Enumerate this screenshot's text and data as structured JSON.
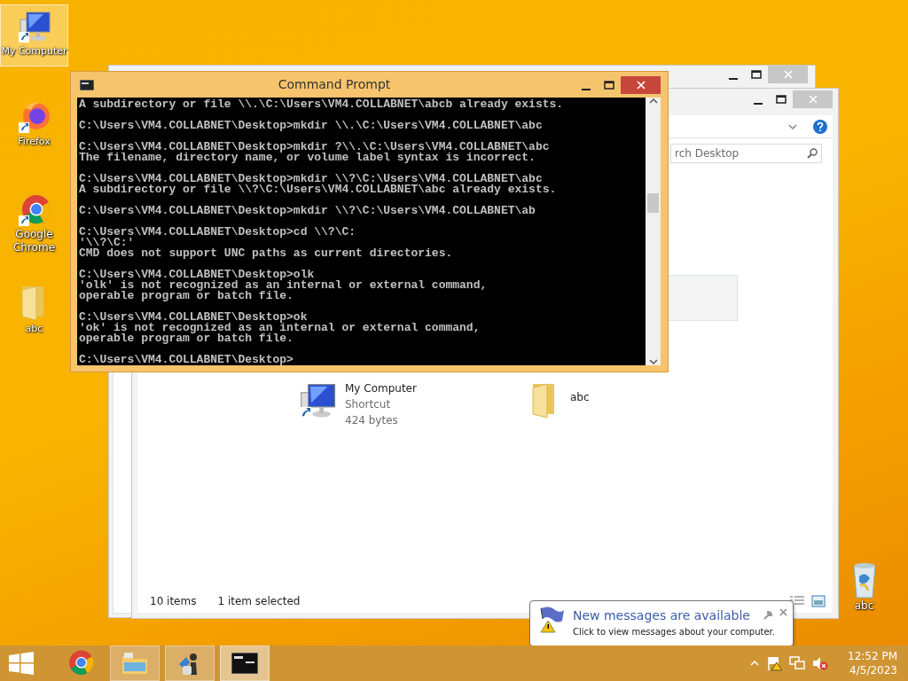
{
  "desktop_icons": [
    {
      "label": "My Computer",
      "kind": "computer",
      "selected": true
    },
    {
      "label": "Firefox",
      "kind": "firefox",
      "selected": false
    },
    {
      "label": "Google Chrome",
      "kind": "chrome",
      "selected": false
    },
    {
      "label": "abc",
      "kind": "folder",
      "selected": false
    }
  ],
  "recycle_bin": {
    "label": "abc"
  },
  "explorer": {
    "search": {
      "text": "rch Desktop"
    },
    "items": [
      {
        "kind": "shortcut",
        "name": "My Computer",
        "details": [
          "Shortcut",
          "424 bytes"
        ]
      },
      {
        "kind": "folder",
        "name": "abc"
      }
    ],
    "status": {
      "count": "10 items",
      "selection": "1 item selected"
    }
  },
  "cmd": {
    "title": "Command Prompt",
    "blocks": [
      [
        "A subdirectory or file \\\\.\\C:\\Users\\VM4.COLLABNET\\abcb already exists."
      ],
      [
        "C:\\Users\\VM4.COLLABNET\\Desktop>mkdir \\\\.\\C:\\Users\\VM4.COLLABNET\\abc"
      ],
      [
        "C:\\Users\\VM4.COLLABNET\\Desktop>mkdir ?\\\\.\\C:\\Users\\VM4.COLLABNET\\abc",
        "The filename, directory name, or volume label syntax is incorrect."
      ],
      [
        "C:\\Users\\VM4.COLLABNET\\Desktop>mkdir \\\\?\\C:\\Users\\VM4.COLLABNET\\abc",
        "A subdirectory or file \\\\?\\C:\\Users\\VM4.COLLABNET\\abc already exists."
      ],
      [
        "C:\\Users\\VM4.COLLABNET\\Desktop>mkdir \\\\?\\C:\\Users\\VM4.COLLABNET\\ab"
      ],
      [
        "C:\\Users\\VM4.COLLABNET\\Desktop>cd \\\\?\\C:",
        "'\\\\?\\C:'",
        "CMD does not support UNC paths as current directories."
      ],
      [
        "C:\\Users\\VM4.COLLABNET\\Desktop>olk",
        "'olk' is not recognized as an internal or external command,",
        "operable program or batch file."
      ],
      [
        "C:\\Users\\VM4.COLLABNET\\Desktop>ok",
        "'ok' is not recognized as an internal or external command,",
        "operable program or batch file."
      ],
      [
        "C:\\Users\\VM4.COLLABNET\\Desktop>"
      ]
    ]
  },
  "notification": {
    "title": "New messages are available",
    "text": "Click to view messages about your computer."
  },
  "taskbar": {
    "buttons": [
      {
        "kind": "start",
        "open": false,
        "active": false
      },
      {
        "kind": "chrome",
        "open": false,
        "active": false
      },
      {
        "kind": "explorer",
        "open": true,
        "active": false
      },
      {
        "kind": "chess",
        "open": true,
        "active": false
      },
      {
        "kind": "cmd",
        "open": true,
        "active": true
      }
    ],
    "clock": {
      "time": "12:52 PM",
      "date": "4/5/2023"
    }
  }
}
